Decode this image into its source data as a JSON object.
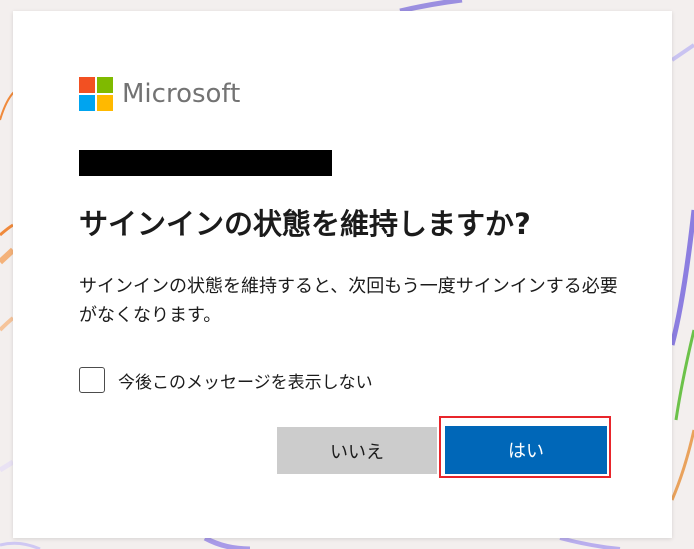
{
  "brand": {
    "name": "Microsoft",
    "logo_colors": [
      "#f25022",
      "#7fba00",
      "#00a4ef",
      "#ffb900"
    ]
  },
  "account": {
    "identifier": "",
    "redacted": true
  },
  "dialog": {
    "title": "サインインの状態を維持しますか?",
    "description": "サインインの状態を維持すると、次回もう一度サインインする必要がなくなります。",
    "checkbox": {
      "label": "今後このメッセージを表示しない",
      "checked": false
    },
    "buttons": {
      "no_label": "いいえ",
      "yes_label": "はい"
    }
  },
  "colors": {
    "primary_button": "#0067b8",
    "secondary_button": "#cccccc",
    "highlight_border": "#e8252b",
    "background": "#f3efee"
  }
}
